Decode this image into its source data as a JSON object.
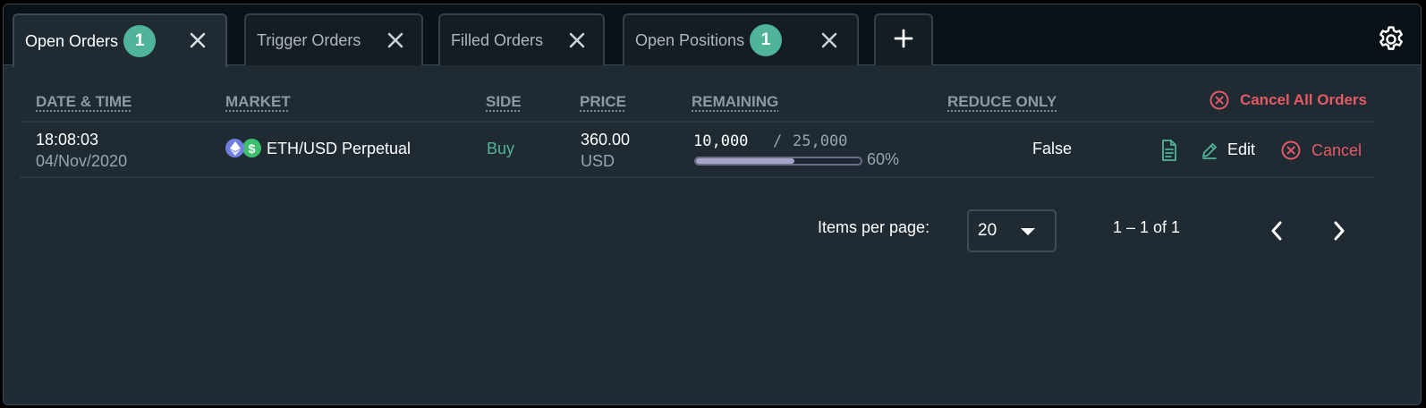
{
  "tabs": [
    {
      "label": "Open Orders",
      "badge": "1"
    },
    {
      "label": "Trigger Orders"
    },
    {
      "label": "Filled Orders"
    },
    {
      "label": "Open Positions",
      "badge": "1"
    }
  ],
  "table": {
    "headers": {
      "datetime": "DATE & TIME",
      "market": "MARKET",
      "side": "SIDE",
      "price": "PRICE",
      "remaining": "REMAINING",
      "reduce_only": "REDUCE ONLY"
    },
    "cancel_all_label": "Cancel All Orders",
    "rows": [
      {
        "time": "18:08:03",
        "date": "04/Nov/2020",
        "market": "ETH/USD Perpetual",
        "side": "Buy",
        "price": "360.00",
        "price_unit": "USD",
        "remaining": "10,000",
        "remaining_sep": "/",
        "total": "25,000",
        "remaining_fraction": 0.6,
        "percent": "60%",
        "reduce_only": "False",
        "edit_label": "Edit",
        "cancel_label": "Cancel"
      }
    ]
  },
  "pagination": {
    "items_per_page_label": "Items per page:",
    "items_per_page_value": "20",
    "range_label": "1 – 1 of 1"
  },
  "colors": {
    "accent_green": "#4fb49a",
    "danger_red": "#e45b66",
    "panel_bg": "#1f2a33"
  },
  "icons": {
    "tab_close": "close-icon",
    "add_tab": "plus-icon",
    "settings": "gear-icon",
    "cancel_all": "circle-x-icon",
    "market_coins": [
      "ethereum-icon",
      "usd-coin-icon"
    ],
    "details": "document-icon",
    "edit": "pencil-icon",
    "cancel": "circle-x-icon",
    "prev_page": "chevron-left-icon",
    "next_page": "chevron-right-icon"
  }
}
